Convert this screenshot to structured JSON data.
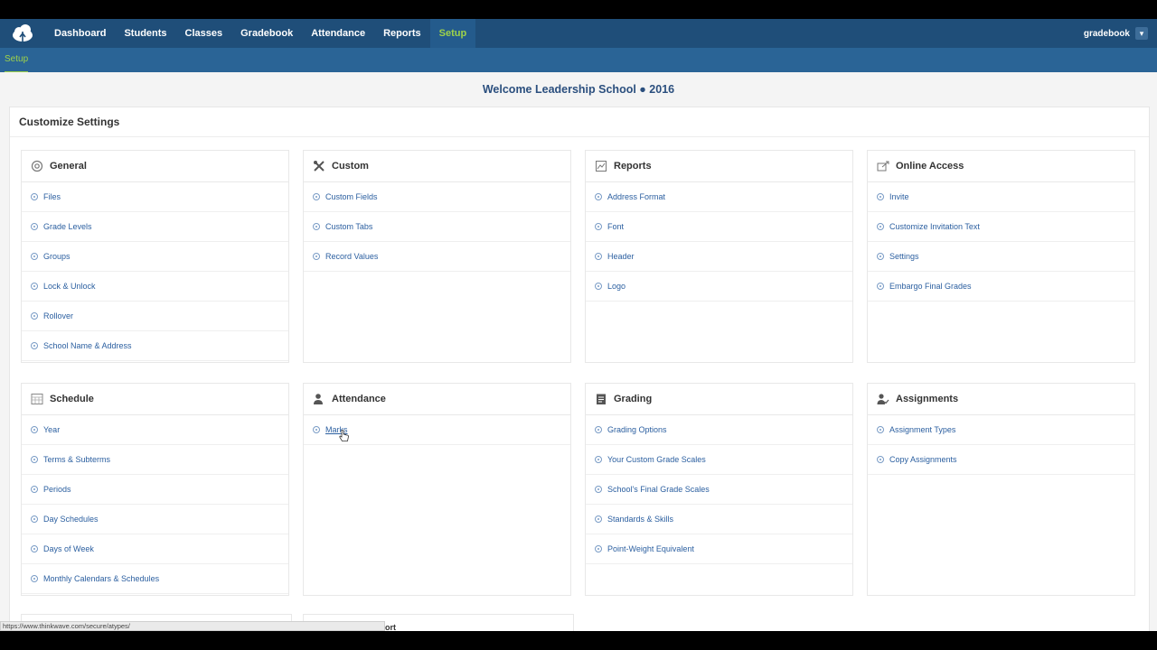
{
  "nav": {
    "items": [
      {
        "label": "Dashboard",
        "active": false
      },
      {
        "label": "Students",
        "active": false
      },
      {
        "label": "Classes",
        "active": false
      },
      {
        "label": "Gradebook",
        "active": false
      },
      {
        "label": "Attendance",
        "active": false
      },
      {
        "label": "Reports",
        "active": false
      },
      {
        "label": "Setup",
        "active": true
      }
    ],
    "user": "gradebook"
  },
  "subnav": {
    "active_tab": "Setup"
  },
  "welcome": "Welcome Leadership School  ● 2016",
  "panel": {
    "title": "Customize Settings"
  },
  "cards": [
    {
      "title": "General",
      "icon": "gear-icon",
      "items": [
        "Files",
        "Grade Levels",
        "Groups",
        "Lock & Unlock",
        "Rollover",
        "School Name & Address"
      ]
    },
    {
      "title": "Custom",
      "icon": "tools-icon",
      "items": [
        "Custom Fields",
        "Custom Tabs",
        "Record Values"
      ]
    },
    {
      "title": "Reports",
      "icon": "report-icon",
      "items": [
        "Address Format",
        "Font",
        "Header",
        "Logo"
      ]
    },
    {
      "title": "Online Access",
      "icon": "online-access-icon",
      "items": [
        "Invite",
        "Customize Invitation Text",
        "Settings",
        "Embargo Final Grades"
      ]
    },
    {
      "title": "Schedule",
      "icon": "calendar-icon",
      "items": [
        "Year",
        "Terms & Subterms",
        "Periods",
        "Day Schedules",
        "Days of Week",
        "Monthly Calendars & Schedules"
      ]
    },
    {
      "title": "Attendance",
      "icon": "person-icon",
      "items": [
        "Marks"
      ]
    },
    {
      "title": "Grading",
      "icon": "clipboard-icon",
      "items": [
        "Grading Options",
        "Your Custom Grade Scales",
        "School's Final Grade Scales",
        "Standards & Skills",
        "Point-Weight Equivalent"
      ]
    },
    {
      "title": "Assignments",
      "icon": "person-check-icon",
      "items": [
        "Assignment Types",
        "Copy Assignments"
      ]
    }
  ],
  "statusbar": {
    "url": "https://www.thinkwave.com/secure/atypes/"
  },
  "partial_label": "ort",
  "colors": {
    "nav_bg": "#1f4e79",
    "subnav_bg": "#2a6496",
    "accent": "#9ed24a",
    "link": "#2b5fa0",
    "title": "#2b4f7e"
  }
}
